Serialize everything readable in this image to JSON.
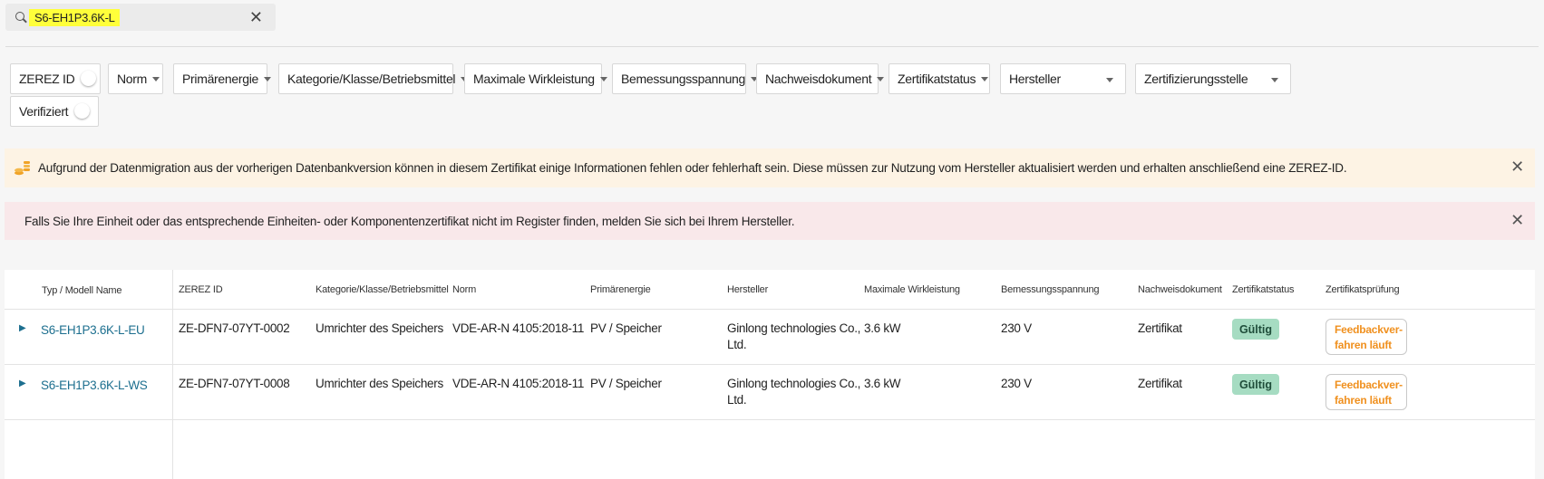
{
  "search": {
    "value": "S6-EH1P3.6K-L",
    "clear_label": "✕"
  },
  "filters": {
    "zerez_id": "ZEREZ ID",
    "norm": "Norm",
    "primaerenergie": "Primärenergie",
    "kategorie": "Kategorie/Klasse/Betriebsmittel",
    "max_wirkleistung": "Maximale Wirkleistung",
    "bemessungsspannung": "Bemessungsspannung",
    "nachweisdokument": "Nachweisdokument",
    "zertifikatstatus": "Zertifikatstatus",
    "hersteller": "Hersteller",
    "zertifizierungsstelle": "Zertifizierungsstelle",
    "verifiziert": "Verifiziert"
  },
  "banners": {
    "warning": "Aufgrund der Datenmigration aus der vorherigen Datenbankversion können in diesem Zertifikat einige Informationen fehlen oder fehlerhaft sein. Diese müssen zur Nutzung vom Hersteller aktualisiert werden und erhalten anschließend eine ZEREZ-ID.",
    "info": "Falls Sie Ihre Einheit oder das entsprechende Einheiten- oder Komponentenzertifikat nicht im Register finden, melden Sie sich bei Ihrem Hersteller.",
    "close_label": "✕"
  },
  "table": {
    "headers": {
      "typ": "Typ / Modell Name",
      "zerez": "ZEREZ ID",
      "kategorie": "Kategorie/Klasse/Betriebsmittel",
      "norm": "Norm",
      "primaer": "Primärenergie",
      "hersteller": "Hersteller",
      "leistung": "Maximale Wirkleistung",
      "spannung": "Bemessungsspannung",
      "nachweis": "Nachweisdokument",
      "status": "Zertifikatstatus",
      "pruefung": "Zertifikatsprüfung"
    },
    "rows": [
      {
        "typ": "S6-EH1P3.6K-L-EU",
        "zerez": "ZE-DFN7-07YT-0002",
        "kategorie": "Umrichter des Speichers",
        "norm": "VDE-AR-N 4105:2018-11",
        "primaer": "PV / Speicher",
        "hersteller_1": "Ginlong technologies Co.,",
        "hersteller_2": "Ltd.",
        "leistung": "3.6 kW",
        "spannung": "230 V",
        "nachweis": "Zertifikat",
        "status": "Gültig",
        "pruefung_1": "Feedbackver-",
        "pruefung_2": "fahren läuft"
      },
      {
        "typ": "S6-EH1P3.6K-L-WS",
        "zerez": "ZE-DFN7-07YT-0008",
        "kategorie": "Umrichter des Speichers",
        "norm": "VDE-AR-N 4105:2018-11",
        "primaer": "PV / Speicher",
        "hersteller_1": "Ginlong technologies Co.,",
        "hersteller_2": "Ltd.",
        "leistung": "3.6 kW",
        "spannung": "230 V",
        "nachweis": "Zertifikat",
        "status": "Gültig",
        "pruefung_1": "Feedbackver-",
        "pruefung_2": "fahren läuft"
      }
    ]
  }
}
